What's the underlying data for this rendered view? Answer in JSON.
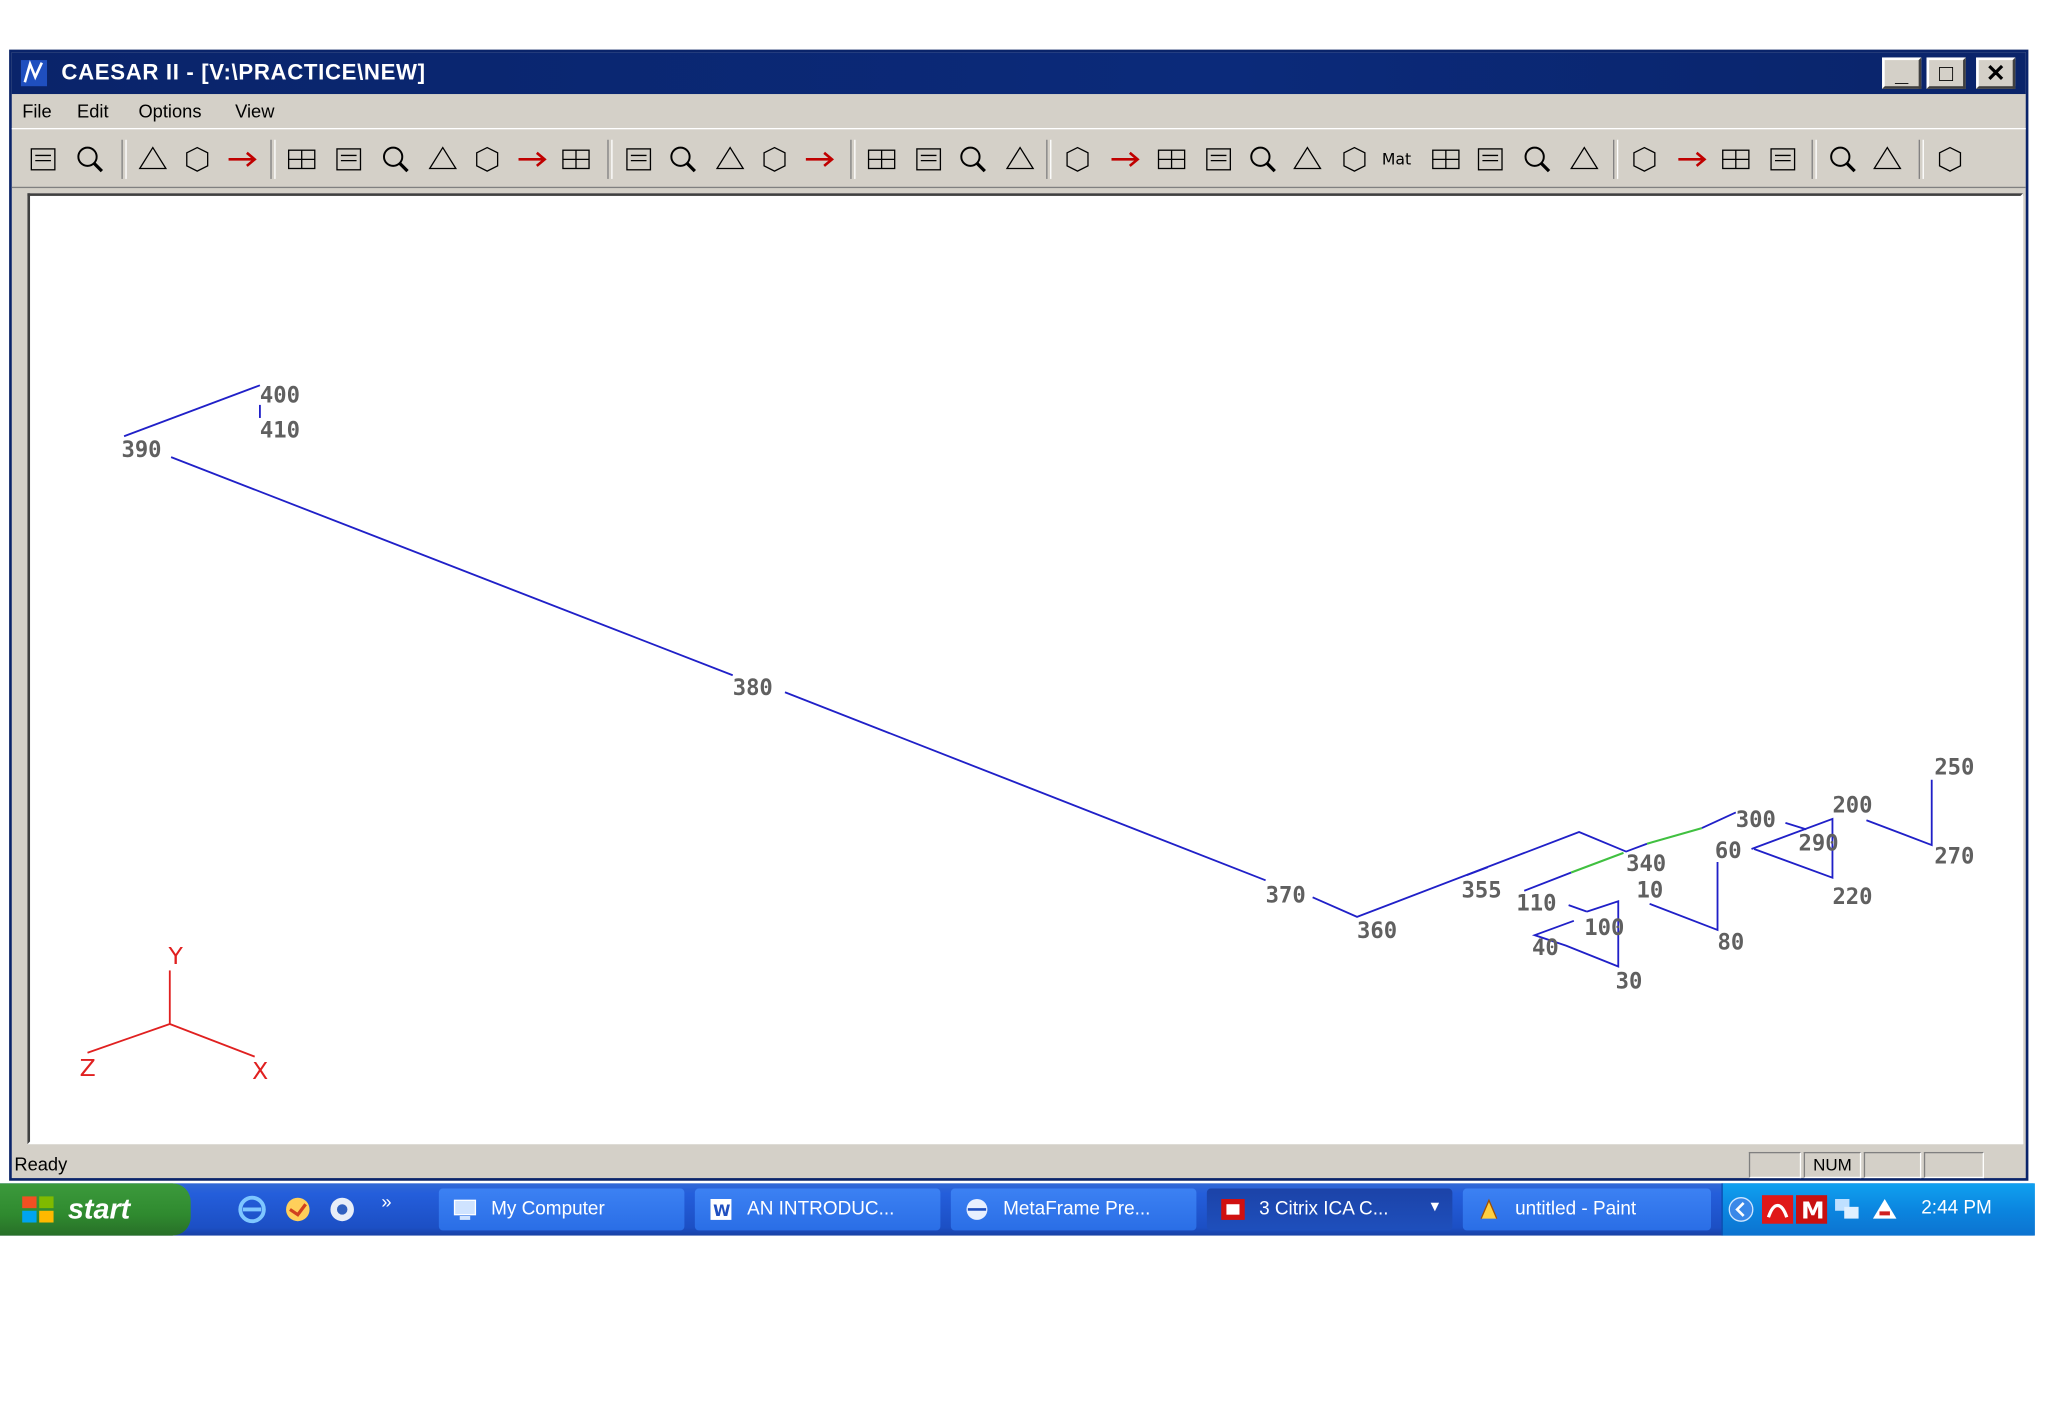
{
  "window": {
    "title": "CAESAR II - [V:\\PRACTICE\\NEW]",
    "controls": {
      "minimize": "_",
      "maximize": "□",
      "close": "✕"
    }
  },
  "menu": {
    "items": [
      "File",
      "Edit",
      "Options",
      "View"
    ]
  },
  "toolbar": {
    "icons": [
      "print-icon",
      "print-preview-icon",
      "zoom-in-icon",
      "zoom-out-icon",
      "zoom-window-icon",
      "rotate-icon",
      "rotate-x-icon",
      "rotate-y-icon",
      "rotate-z-icon",
      "rotate-xy-icon",
      "rotate-yz-icon",
      "rotate-zx-icon",
      "iso-view-icon",
      "front-view-icon",
      "solid-view-icon",
      "four-view-icon",
      "hidden-view-icon",
      "color-icon",
      "hatch-icon",
      "line-hatch-icon",
      "eraser-icon",
      "restraints-icon",
      "anchor-icon",
      "displacement-icon",
      "hanger-icon",
      "nozzle-icon",
      "delta-x-icon",
      "force-icon",
      "material-label",
      "bend-icon",
      "tee-icon",
      "node-icon",
      "axes-icon",
      "node-numbers-icon",
      "length-icon",
      "restraint-symbol-icon",
      "dimension-icon",
      "3d-box-icon",
      "markers-icon",
      "pages-icon"
    ],
    "material_label": "Mat"
  },
  "model": {
    "nodes": [
      "400",
      "410",
      "390",
      "380",
      "370",
      "360",
      "355",
      "110",
      "10",
      "340",
      "300",
      "200",
      "290",
      "60",
      "250",
      "270",
      "220",
      "100",
      "40",
      "30",
      "80"
    ]
  },
  "axes": {
    "y": "Y",
    "z": "Z",
    "x": "X"
  },
  "colors": {
    "pipe": "#2020c8",
    "highlight": "#40c040",
    "axis": "#e02020",
    "label": "#606060",
    "title_bar": "#0a246a"
  },
  "status": {
    "text": "Ready",
    "num": "NUM"
  },
  "taskbar": {
    "start": "start",
    "tasks": [
      "My Computer",
      "AN INTRODUC...",
      "MetaFrame Pre...",
      "3 Citrix ICA C...",
      "untitled - Paint"
    ],
    "clock": "2:44 PM"
  }
}
